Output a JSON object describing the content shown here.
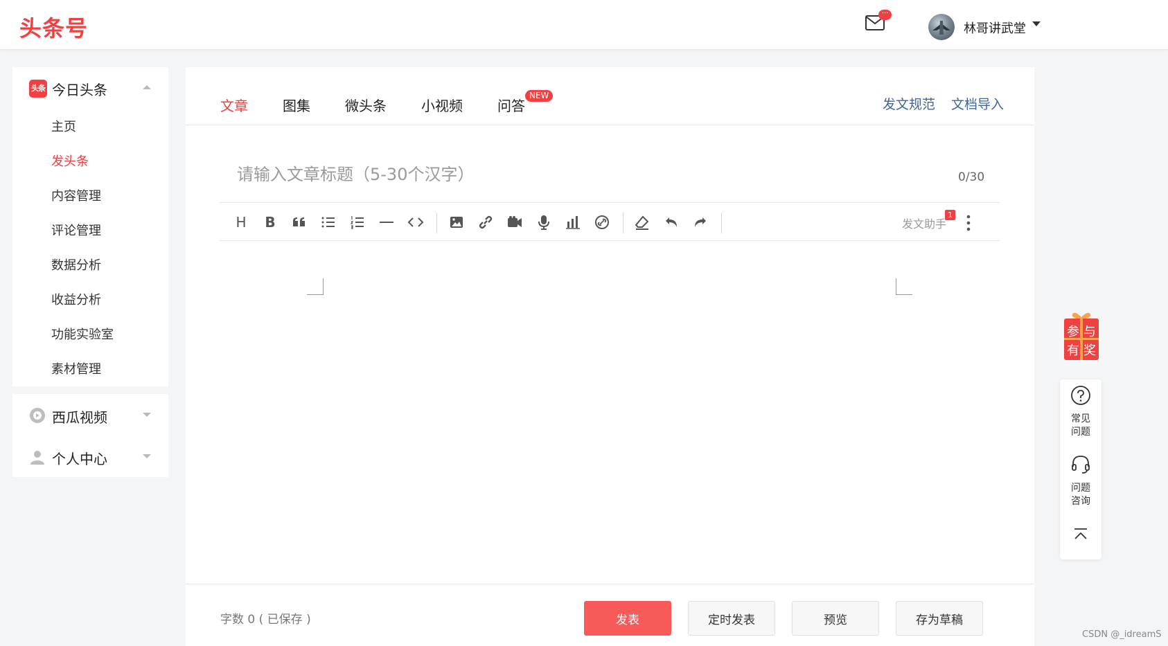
{
  "header": {
    "logo": "头条号",
    "mail_badge": "···",
    "user_name": "林哥讲武堂"
  },
  "sidebar": {
    "main_group": {
      "icon_label": "头条",
      "label": "今日头条",
      "items": [
        {
          "label": "主页",
          "active": false
        },
        {
          "label": "发头条",
          "active": true
        },
        {
          "label": "内容管理",
          "active": false
        },
        {
          "label": "评论管理",
          "active": false
        },
        {
          "label": "数据分析",
          "active": false
        },
        {
          "label": "收益分析",
          "active": false
        },
        {
          "label": "功能实验室",
          "active": false
        },
        {
          "label": "素材管理",
          "active": false
        }
      ]
    },
    "xigua": {
      "label": "西瓜视频"
    },
    "personal": {
      "label": "个人中心"
    }
  },
  "editor": {
    "tabs": [
      {
        "label": "文章"
      },
      {
        "label": "图集"
      },
      {
        "label": "微头条"
      },
      {
        "label": "小视频"
      },
      {
        "label": "问答"
      }
    ],
    "new_badge": "NEW",
    "links": {
      "rules": "发文规范",
      "import": "文档导入"
    },
    "title_placeholder": "请输入文章标题（5-30个汉字）",
    "title_count": "0/30",
    "toolbar": {
      "heading": "H",
      "bold": "B",
      "assistant_label": "发文助手",
      "assistant_badge": "1"
    },
    "footer": {
      "word_count": "字数 0 ( 已保存 )",
      "publish": "发表",
      "schedule": "定时发表",
      "preview": "预览",
      "draft": "存为草稿"
    }
  },
  "right_panel": {
    "gift_text": [
      "参",
      "与",
      "有",
      "奖"
    ],
    "faq": "常见\n问题",
    "consult": "问题\n咨询"
  },
  "watermark": "CSDN @_idreamS",
  "colors": {
    "brand": "#f04142",
    "link": "#406599",
    "publish_button": "#f85959"
  }
}
